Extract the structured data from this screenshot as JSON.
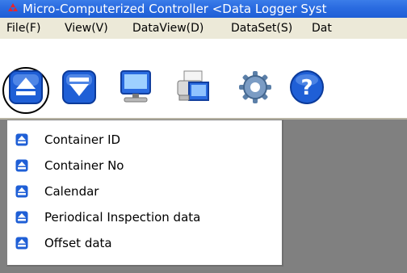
{
  "window": {
    "title": "Micro-Computerized Controller <Data Logger Syst"
  },
  "menu": {
    "items": [
      "File(F)",
      "View(V)",
      "DataView(D)",
      "DataSet(S)",
      "Dat"
    ]
  },
  "toolbar": {
    "buttons": [
      {
        "icon": "eject-up-icon"
      },
      {
        "icon": "eject-down-icon"
      },
      {
        "icon": "computer-icon"
      },
      {
        "icon": "printer-icon"
      },
      {
        "icon": "gear-icon"
      },
      {
        "icon": "help-icon"
      }
    ]
  },
  "dropdown": {
    "items": [
      {
        "label": "Container ID"
      },
      {
        "label": "Container No"
      },
      {
        "label": "Calendar"
      },
      {
        "label": "Periodical Inspection data"
      },
      {
        "label": "Offset data"
      }
    ]
  },
  "colors": {
    "title_bar": "#2a6be0",
    "menu_bar": "#ece9d8",
    "workspace": "#808080",
    "icon_blue": "#1f5fd6"
  }
}
